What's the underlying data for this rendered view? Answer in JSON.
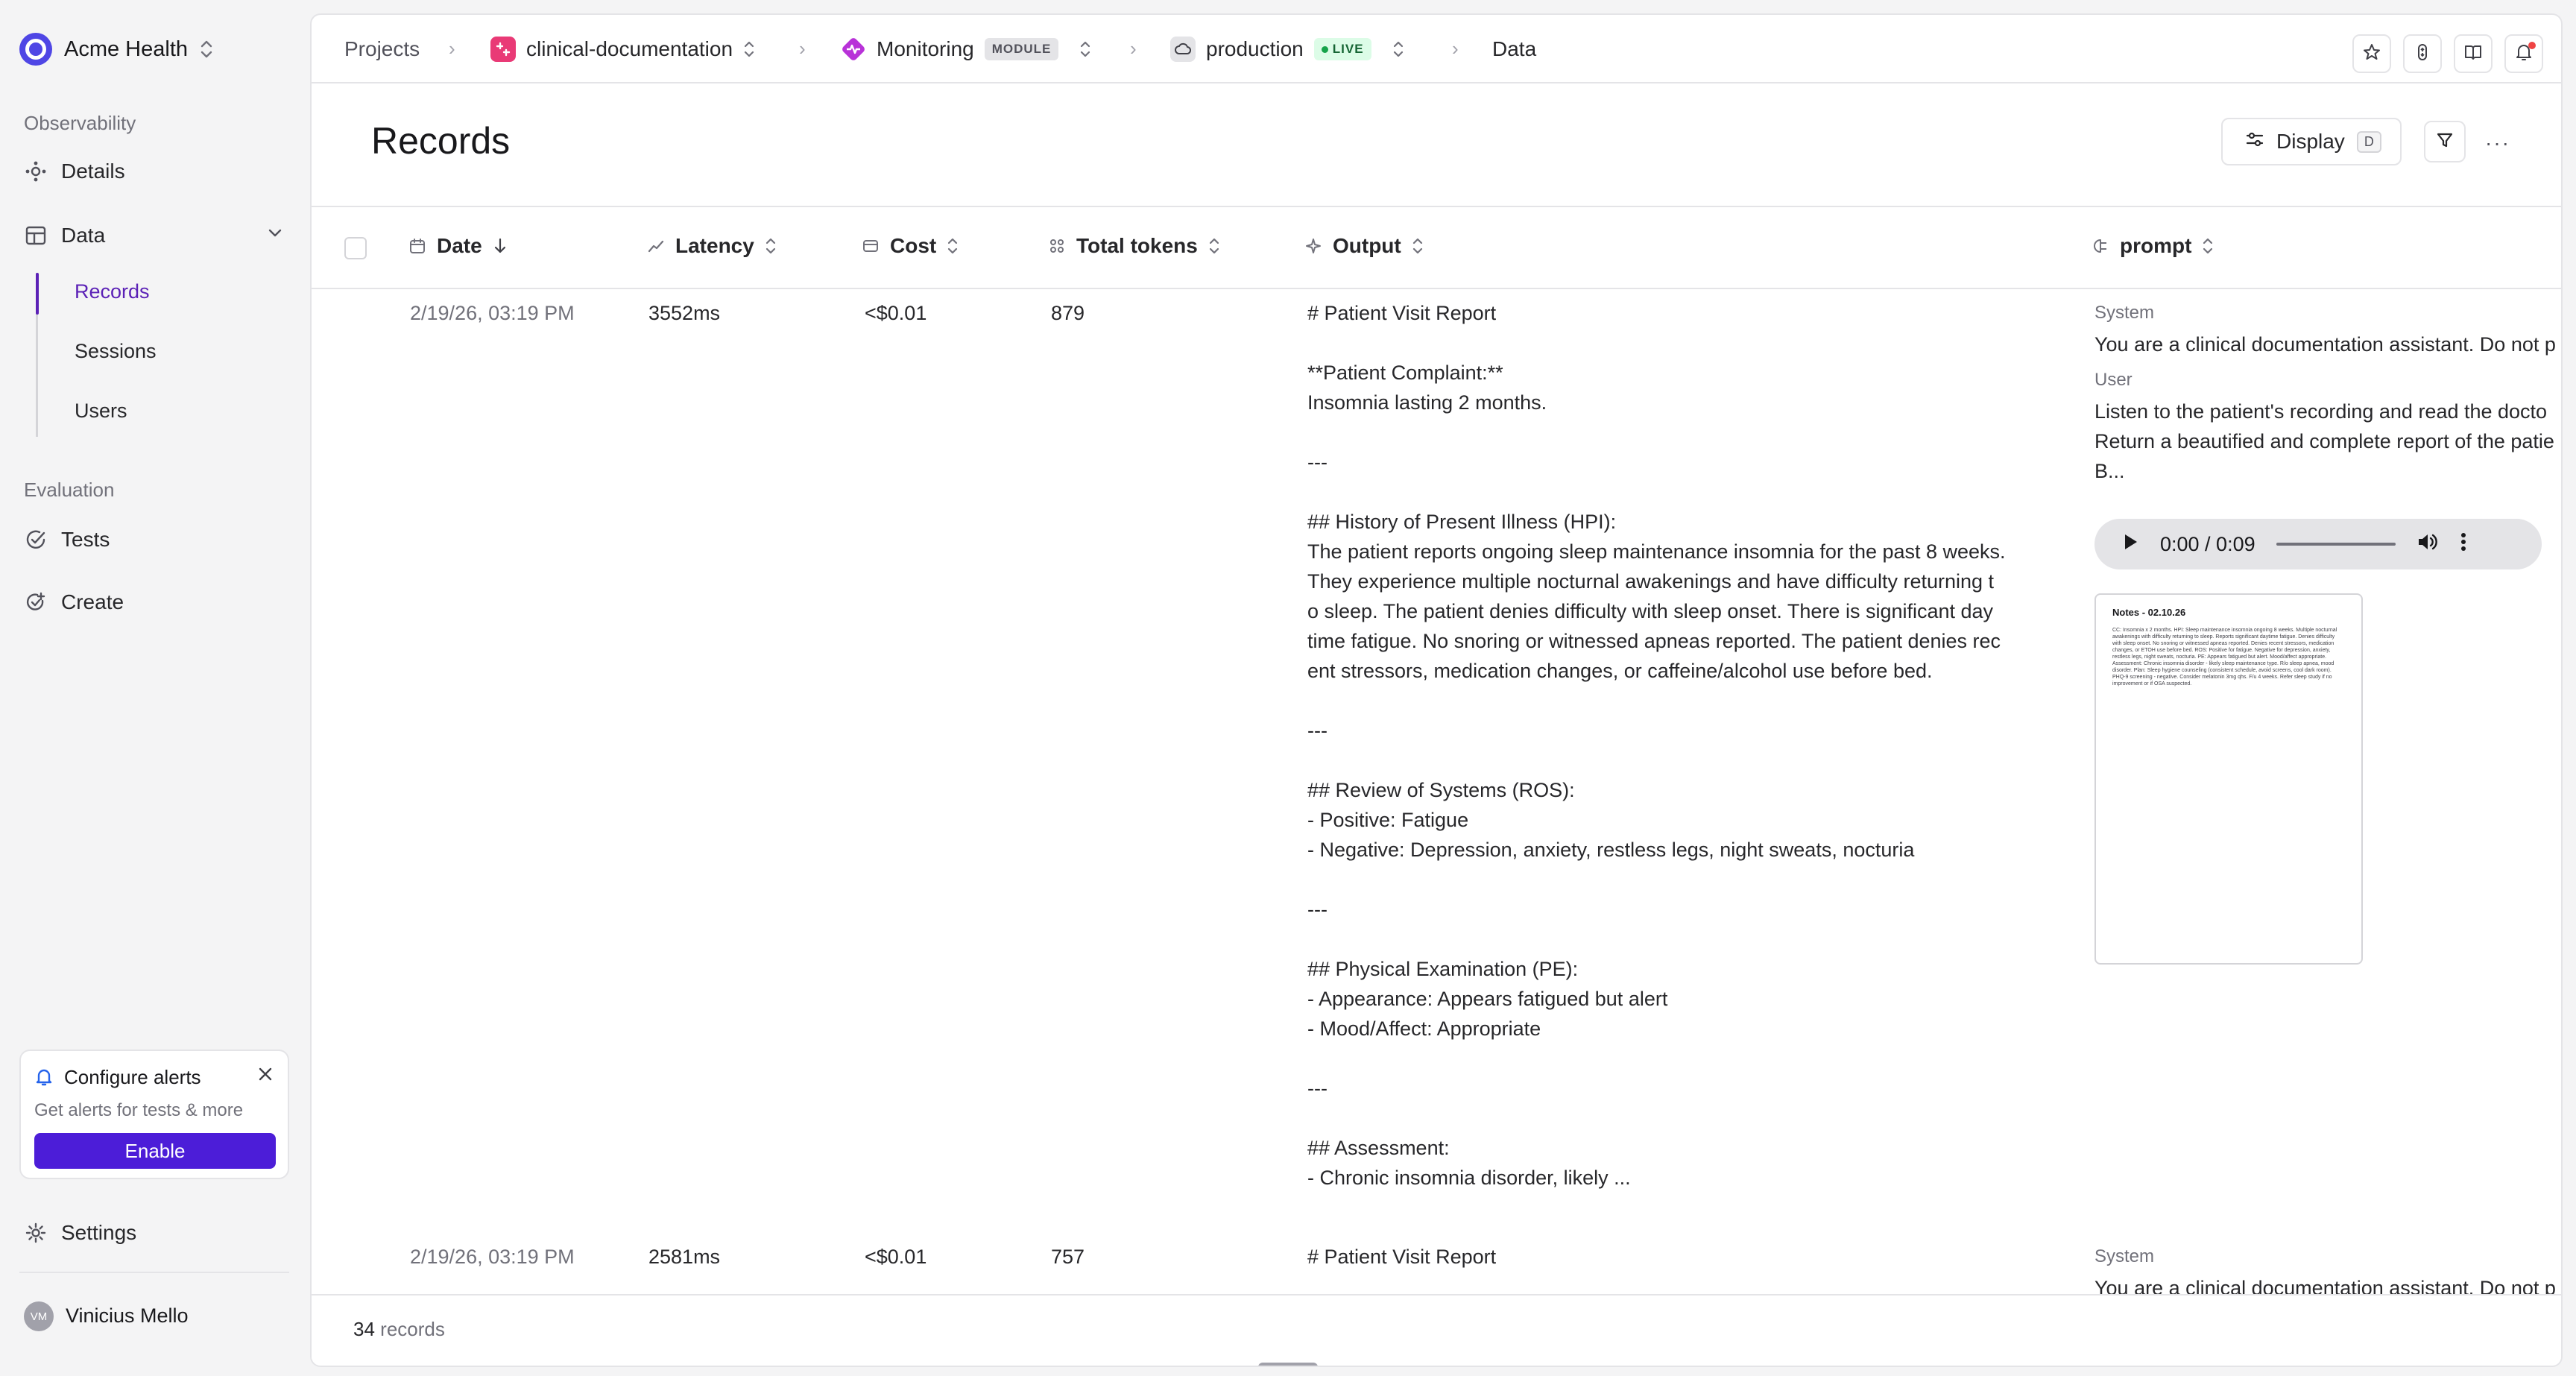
{
  "org": {
    "name": "Acme Health"
  },
  "sidebar": {
    "observability_label": "Observability",
    "details": "Details",
    "data": "Data",
    "records": "Records",
    "sessions": "Sessions",
    "users": "Users",
    "evaluation_label": "Evaluation",
    "tests": "Tests",
    "create": "Create",
    "settings": "Settings"
  },
  "alert": {
    "title": "Configure alerts",
    "description": "Get alerts for tests & more",
    "button": "Enable"
  },
  "user": {
    "name": "Vinicius Mello",
    "initials": "VM"
  },
  "breadcrumb": {
    "projects": "Projects",
    "project": "clinical-documentation",
    "module": "Monitoring",
    "module_badge": "MODULE",
    "environment": "production",
    "env_badge": "LIVE",
    "current": "Data"
  },
  "page": {
    "title": "Records"
  },
  "toolbar": {
    "display": "Display",
    "display_key": "D",
    "more": "···"
  },
  "columns": {
    "date": "Date",
    "latency": "Latency",
    "cost": "Cost",
    "tokens": "Total tokens",
    "output": "Output",
    "prompt": "prompt"
  },
  "rows": [
    {
      "date": "2/19/26, 03:19 PM",
      "latency": "3552ms",
      "cost": "<$0.01",
      "tokens": "879",
      "output": "# Patient Visit Report\n\n**Patient Complaint:**\nInsomnia lasting 2 months.\n\n---\n\n## History of Present Illness (HPI):\nThe patient reports ongoing sleep maintenance insomnia for the past 8 weeks.\nThey experience multiple nocturnal awakenings and have difficulty returning t\no sleep. The patient denies difficulty with sleep onset. There is significant day\ntime fatigue. No snoring or witnessed apneas reported. The patient denies rec\nent stressors, medication changes, or caffeine/alcohol use before bed.\n\n---\n\n## Review of Systems (ROS):\n- Positive: Fatigue\n- Negative: Depression, anxiety, restless legs, night sweats, nocturia\n\n---\n\n## Physical Examination (PE):\n- Appearance: Appears fatigued but alert\n- Mood/Affect: Appropriate\n\n---\n\n## Assessment:\n- Chronic insomnia disorder, likely ...",
      "system_label": "System",
      "system_text": "You are a clinical documentation assistant. Do not p",
      "user_label": "User",
      "user_text_1": "Listen to the patient's recording and read the docto",
      "user_text_2": "Return a beautified and complete report of the patie",
      "user_text_3": "B...",
      "audio_time": "0:00 / 0:09",
      "note_title": "Notes - 02.10.26",
      "note_body": "CC: Insomnia x 2 months. HPI: Sleep maintenance insomnia ongoing 8 weeks. Multiple nocturnal awakenings with difficulty returning to sleep. Reports significant daytime fatigue. Denies difficulty with sleep onset. No snoring or witnessed apneas reported. Denies recent stressors, medication changes, or ETOH use before bed. ROS: Positive for fatigue. Negative for depression, anxiety, restless legs, night sweats, nocturia. PE: Appears fatigued but alert. Mood/affect appropriate. Assessment: Chronic insomnia disorder - likely sleep maintenance type. R/o sleep apnea, mood disorder. Plan: Sleep hygiene counseling (consistent schedule, avoid screens, cool dark room). PHQ-9 screening - negative. Consider melatonin 3mg qhs. F/u 4 weeks. Refer sleep study if no improvement or if OSA suspected."
    },
    {
      "date": "2/19/26, 03:19 PM",
      "latency": "2581ms",
      "cost": "<$0.01",
      "tokens": "757",
      "output": "# Patient Visit Report",
      "system_label": "System",
      "system_text": "You are a clinical documentation assistant. Do not p"
    }
  ],
  "footer": {
    "count": "34",
    "count_label": "records"
  },
  "colors": {
    "accent": "#4c1dd8",
    "active_nav": "#5b21b6",
    "live_green": "#16a34a",
    "project_pink": "#e93a76"
  }
}
